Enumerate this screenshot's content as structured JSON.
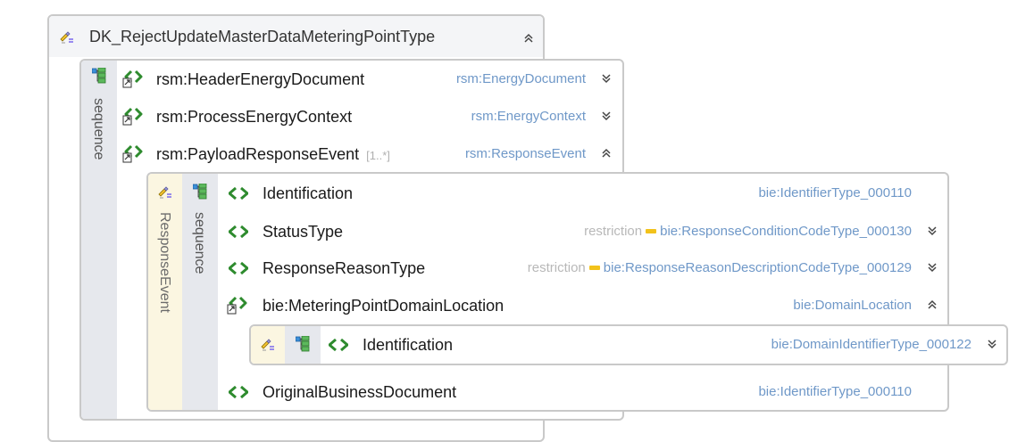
{
  "root": {
    "title": "DK_RejectUpdateMasterDataMeteringPointType",
    "sequence_label": "sequence"
  },
  "elements": [
    {
      "name": "rsm:HeaderEnergyDocument",
      "type": "rsm:EnergyDocument"
    },
    {
      "name": "rsm:ProcessEnergyContext",
      "type": "rsm:EnergyContext"
    },
    {
      "name": "rsm:PayloadResponseEvent",
      "multiplicity": "[1..*]",
      "type": "rsm:ResponseEvent"
    }
  ],
  "response_event": {
    "label": "ResponseEvent",
    "sequence_label": "sequence",
    "items": [
      {
        "name": "Identification",
        "type": "bie:IdentifierType_000110"
      },
      {
        "name": "StatusType",
        "restriction": "restriction",
        "type": "bie:ResponseConditionCodeType_000130"
      },
      {
        "name": "ResponseReasonType",
        "restriction": "restriction",
        "type": "bie:ResponseReasonDescriptionCodeType_000129"
      },
      {
        "name": "bie:MeteringPointDomainLocation",
        "type": "bie:DomainLocation"
      },
      {
        "name": "OriginalBusinessDocument",
        "type": "bie:IdentifierType_000110"
      }
    ],
    "domain_location": {
      "name": "Identification",
      "type": "bie:DomainIdentifierType_000122"
    }
  },
  "icons": {
    "complex_type": "complex-type-icon",
    "sequence": "sequence-icon",
    "element_ref": "element-reference-icon",
    "simple_element": "simple-element-icon",
    "expand": "chevron-down-icon",
    "collapse": "chevron-up-icon"
  },
  "colors": {
    "type_text": "#6f98c8",
    "element_icon": "#3fa63f",
    "seq_strip": "#e6e8ed",
    "response_strip": "#fbf6e1"
  }
}
